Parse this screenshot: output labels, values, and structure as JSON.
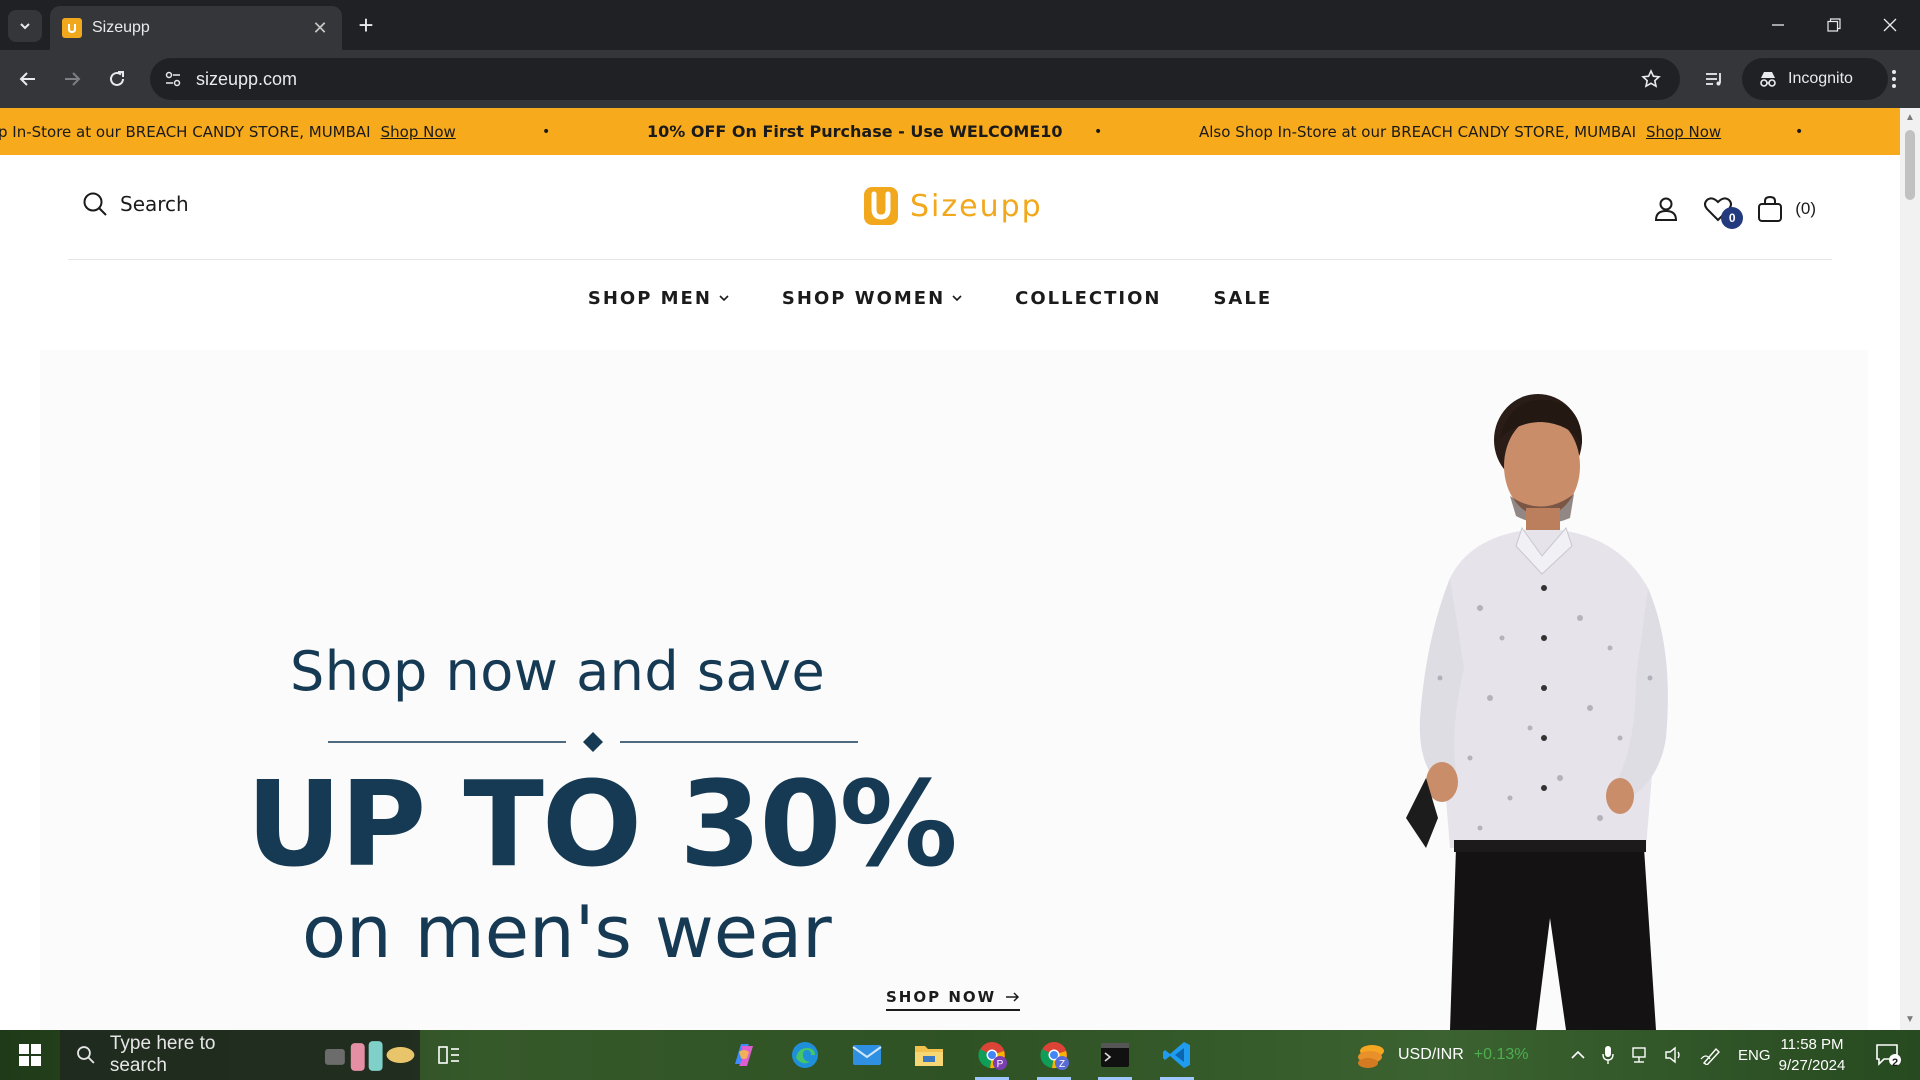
{
  "browser": {
    "tab_title": "Sizeupp",
    "url": "sizeupp.com",
    "incognito_label": "Incognito",
    "new_tab": "+",
    "tab_close": "✕"
  },
  "announcement": {
    "seg1_text": "p In-Store at our BREACH CANDY STORE, MUMBAI",
    "seg1_link": "Shop Now",
    "seg2_text": "10% OFF On First Purchase - Use WELCOME10",
    "seg3_text": "Also Shop In-Store at our BREACH CANDY STORE, MUMBAI",
    "seg3_link": "Shop Now",
    "separator": "•"
  },
  "header": {
    "search_label": "Search",
    "logo_text": "Sizeupp",
    "wishlist_count": "0",
    "cart_count": "(0)"
  },
  "nav": {
    "items": [
      {
        "label": "SHOP MEN",
        "has_dropdown": true
      },
      {
        "label": "SHOP WOMEN",
        "has_dropdown": true
      },
      {
        "label": "COLLECTION",
        "has_dropdown": false
      },
      {
        "label": "SALE",
        "has_dropdown": false
      }
    ]
  },
  "hero": {
    "line1": "Shop now and save",
    "line2": "UP TO 30%",
    "line3": "on men's wear",
    "cta": "SHOP NOW",
    "text_color": "#163a54"
  },
  "taskbar": {
    "search_placeholder": "Type here to search",
    "ticker_label": "USD/INR",
    "ticker_change": "+0.13%",
    "language": "ENG",
    "time": "11:58 PM",
    "date": "9/27/2024",
    "notification_count": "2"
  },
  "colors": {
    "brand": "#f2a81d",
    "announcement_bg": "#f6aa1c",
    "badge": "#233a7e",
    "ticker_positive": "#4caf50"
  }
}
